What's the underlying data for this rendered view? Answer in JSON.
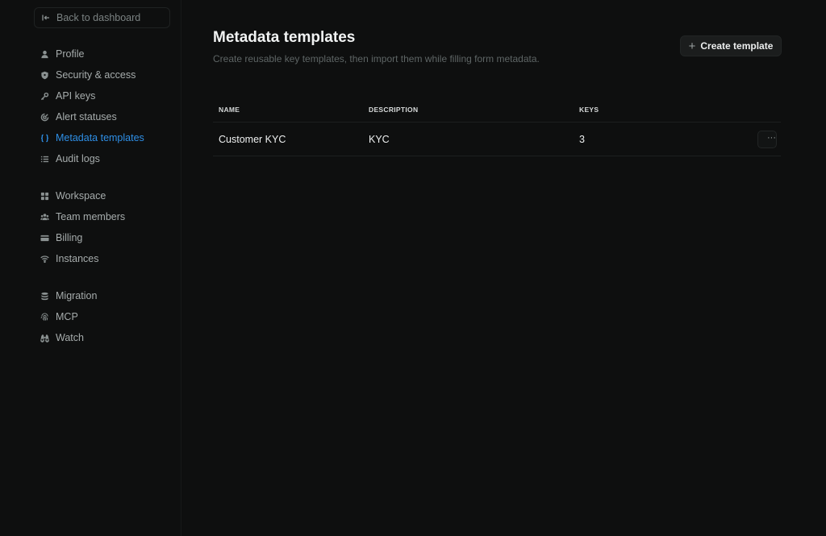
{
  "sidebar": {
    "back_label": "Back to dashboard",
    "groups": [
      [
        {
          "label": "Profile",
          "icon": "user-icon"
        },
        {
          "label": "Security & access",
          "icon": "shield-icon"
        },
        {
          "label": "API keys",
          "icon": "key-icon"
        },
        {
          "label": "Alert statuses",
          "icon": "alert-icon"
        },
        {
          "label": "Metadata templates",
          "icon": "braces-icon",
          "active": true
        },
        {
          "label": "Audit logs",
          "icon": "list-icon"
        }
      ],
      [
        {
          "label": "Workspace",
          "icon": "grid-icon"
        },
        {
          "label": "Team members",
          "icon": "users-icon"
        },
        {
          "label": "Billing",
          "icon": "credit-card-icon"
        },
        {
          "label": "Instances",
          "icon": "wifi-icon"
        }
      ],
      [
        {
          "label": "Migration",
          "icon": "database-icon"
        },
        {
          "label": "MCP",
          "icon": "fingerprint-icon"
        },
        {
          "label": "Watch",
          "icon": "binoculars-icon"
        }
      ]
    ]
  },
  "main": {
    "title": "Metadata templates",
    "subtitle": "Create reusable key templates, then import them while filling form metadata.",
    "create_label": "Create template"
  },
  "table": {
    "headers": {
      "name": "NAME",
      "description": "DESCRIPTION",
      "keys": "KEYS"
    },
    "rows": [
      {
        "name": "Customer KYC",
        "description": "KYC",
        "keys": "3",
        "menu": "···"
      }
    ]
  },
  "colors": {
    "background": "#0e0f0f",
    "accent": "#2e8fe6",
    "text": "#e6e8e8",
    "muted": "#5e6565"
  }
}
